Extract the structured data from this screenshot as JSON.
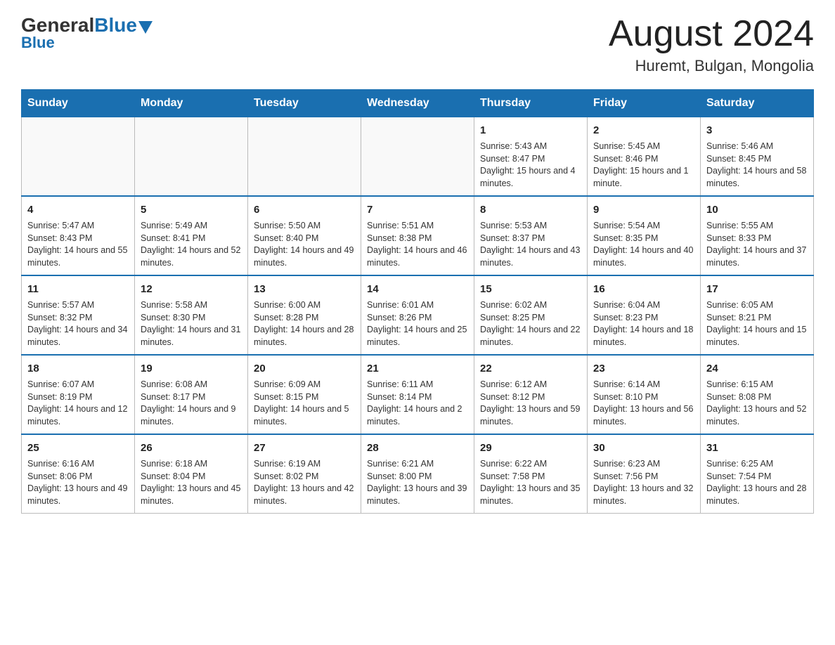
{
  "header": {
    "logo_general": "General",
    "logo_blue": "Blue",
    "month_year": "August 2024",
    "location": "Huremt, Bulgan, Mongolia"
  },
  "days_of_week": [
    "Sunday",
    "Monday",
    "Tuesday",
    "Wednesday",
    "Thursday",
    "Friday",
    "Saturday"
  ],
  "weeks": [
    {
      "cells": [
        {
          "day": "",
          "info": ""
        },
        {
          "day": "",
          "info": ""
        },
        {
          "day": "",
          "info": ""
        },
        {
          "day": "",
          "info": ""
        },
        {
          "day": "1",
          "info": "Sunrise: 5:43 AM\nSunset: 8:47 PM\nDaylight: 15 hours and 4 minutes."
        },
        {
          "day": "2",
          "info": "Sunrise: 5:45 AM\nSunset: 8:46 PM\nDaylight: 15 hours and 1 minute."
        },
        {
          "day": "3",
          "info": "Sunrise: 5:46 AM\nSunset: 8:45 PM\nDaylight: 14 hours and 58 minutes."
        }
      ]
    },
    {
      "cells": [
        {
          "day": "4",
          "info": "Sunrise: 5:47 AM\nSunset: 8:43 PM\nDaylight: 14 hours and 55 minutes."
        },
        {
          "day": "5",
          "info": "Sunrise: 5:49 AM\nSunset: 8:41 PM\nDaylight: 14 hours and 52 minutes."
        },
        {
          "day": "6",
          "info": "Sunrise: 5:50 AM\nSunset: 8:40 PM\nDaylight: 14 hours and 49 minutes."
        },
        {
          "day": "7",
          "info": "Sunrise: 5:51 AM\nSunset: 8:38 PM\nDaylight: 14 hours and 46 minutes."
        },
        {
          "day": "8",
          "info": "Sunrise: 5:53 AM\nSunset: 8:37 PM\nDaylight: 14 hours and 43 minutes."
        },
        {
          "day": "9",
          "info": "Sunrise: 5:54 AM\nSunset: 8:35 PM\nDaylight: 14 hours and 40 minutes."
        },
        {
          "day": "10",
          "info": "Sunrise: 5:55 AM\nSunset: 8:33 PM\nDaylight: 14 hours and 37 minutes."
        }
      ]
    },
    {
      "cells": [
        {
          "day": "11",
          "info": "Sunrise: 5:57 AM\nSunset: 8:32 PM\nDaylight: 14 hours and 34 minutes."
        },
        {
          "day": "12",
          "info": "Sunrise: 5:58 AM\nSunset: 8:30 PM\nDaylight: 14 hours and 31 minutes."
        },
        {
          "day": "13",
          "info": "Sunrise: 6:00 AM\nSunset: 8:28 PM\nDaylight: 14 hours and 28 minutes."
        },
        {
          "day": "14",
          "info": "Sunrise: 6:01 AM\nSunset: 8:26 PM\nDaylight: 14 hours and 25 minutes."
        },
        {
          "day": "15",
          "info": "Sunrise: 6:02 AM\nSunset: 8:25 PM\nDaylight: 14 hours and 22 minutes."
        },
        {
          "day": "16",
          "info": "Sunrise: 6:04 AM\nSunset: 8:23 PM\nDaylight: 14 hours and 18 minutes."
        },
        {
          "day": "17",
          "info": "Sunrise: 6:05 AM\nSunset: 8:21 PM\nDaylight: 14 hours and 15 minutes."
        }
      ]
    },
    {
      "cells": [
        {
          "day": "18",
          "info": "Sunrise: 6:07 AM\nSunset: 8:19 PM\nDaylight: 14 hours and 12 minutes."
        },
        {
          "day": "19",
          "info": "Sunrise: 6:08 AM\nSunset: 8:17 PM\nDaylight: 14 hours and 9 minutes."
        },
        {
          "day": "20",
          "info": "Sunrise: 6:09 AM\nSunset: 8:15 PM\nDaylight: 14 hours and 5 minutes."
        },
        {
          "day": "21",
          "info": "Sunrise: 6:11 AM\nSunset: 8:14 PM\nDaylight: 14 hours and 2 minutes."
        },
        {
          "day": "22",
          "info": "Sunrise: 6:12 AM\nSunset: 8:12 PM\nDaylight: 13 hours and 59 minutes."
        },
        {
          "day": "23",
          "info": "Sunrise: 6:14 AM\nSunset: 8:10 PM\nDaylight: 13 hours and 56 minutes."
        },
        {
          "day": "24",
          "info": "Sunrise: 6:15 AM\nSunset: 8:08 PM\nDaylight: 13 hours and 52 minutes."
        }
      ]
    },
    {
      "cells": [
        {
          "day": "25",
          "info": "Sunrise: 6:16 AM\nSunset: 8:06 PM\nDaylight: 13 hours and 49 minutes."
        },
        {
          "day": "26",
          "info": "Sunrise: 6:18 AM\nSunset: 8:04 PM\nDaylight: 13 hours and 45 minutes."
        },
        {
          "day": "27",
          "info": "Sunrise: 6:19 AM\nSunset: 8:02 PM\nDaylight: 13 hours and 42 minutes."
        },
        {
          "day": "28",
          "info": "Sunrise: 6:21 AM\nSunset: 8:00 PM\nDaylight: 13 hours and 39 minutes."
        },
        {
          "day": "29",
          "info": "Sunrise: 6:22 AM\nSunset: 7:58 PM\nDaylight: 13 hours and 35 minutes."
        },
        {
          "day": "30",
          "info": "Sunrise: 6:23 AM\nSunset: 7:56 PM\nDaylight: 13 hours and 32 minutes."
        },
        {
          "day": "31",
          "info": "Sunrise: 6:25 AM\nSunset: 7:54 PM\nDaylight: 13 hours and 28 minutes."
        }
      ]
    }
  ]
}
